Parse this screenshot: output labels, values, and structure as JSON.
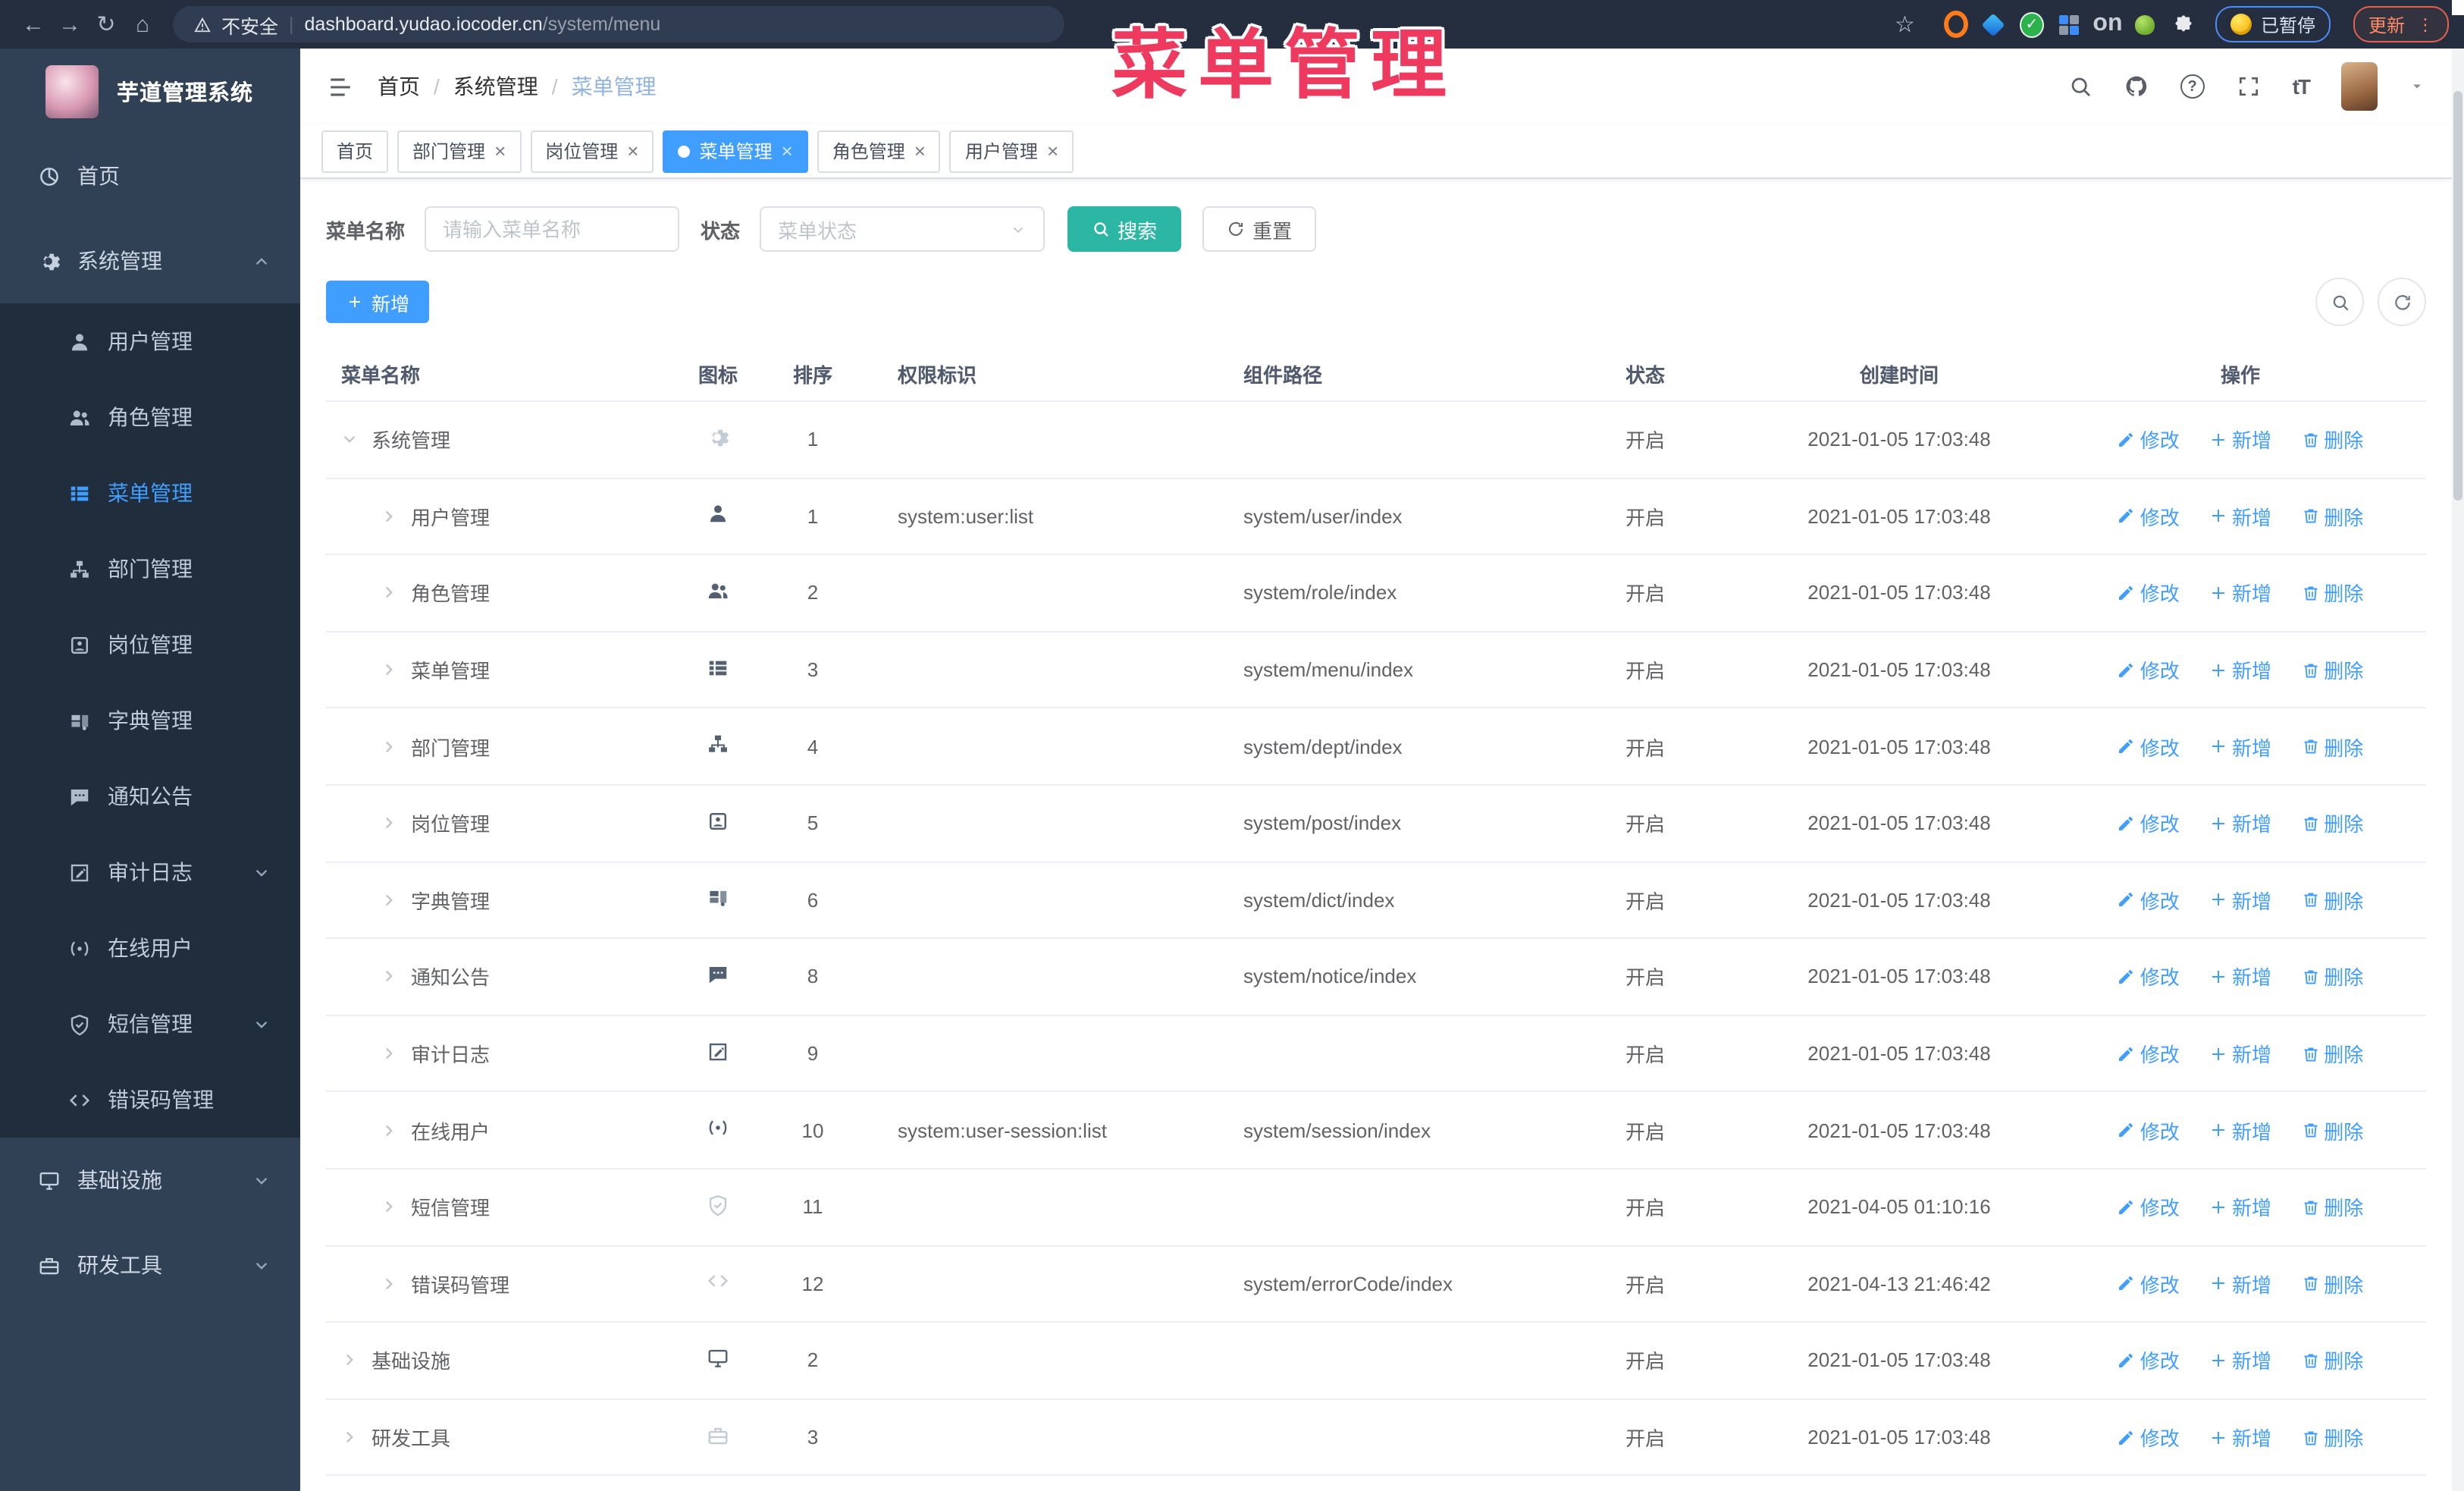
{
  "browser": {
    "security_label": "不安全",
    "url_host": "dashboard.yudao.iocoder.cn",
    "url_path": "/system/menu",
    "paused_label": "已暂停",
    "update_label": "更新"
  },
  "overlay_title": "菜单管理",
  "colors": {
    "accent": "#409eff",
    "search_button": "#2cb7a4",
    "overlay": "#ee3a5f",
    "sidebar": "#304156",
    "submenu": "#1f2d3d"
  },
  "sidebar": {
    "app_title": "芋道管理系统",
    "items": [
      {
        "label": "首页",
        "icon": "dashboard",
        "type": "top",
        "active": false,
        "arrow": ""
      },
      {
        "label": "系统管理",
        "icon": "gear",
        "type": "top",
        "active": false,
        "arrow": "up"
      },
      {
        "label": "用户管理",
        "icon": "user",
        "type": "sub",
        "active": false,
        "arrow": ""
      },
      {
        "label": "角色管理",
        "icon": "users",
        "type": "sub",
        "active": false,
        "arrow": ""
      },
      {
        "label": "菜单管理",
        "icon": "menu",
        "type": "sub",
        "active": true,
        "arrow": ""
      },
      {
        "label": "部门管理",
        "icon": "tree",
        "type": "sub",
        "active": false,
        "arrow": ""
      },
      {
        "label": "岗位管理",
        "icon": "post",
        "type": "sub",
        "active": false,
        "arrow": ""
      },
      {
        "label": "字典管理",
        "icon": "dict",
        "type": "sub",
        "active": false,
        "arrow": ""
      },
      {
        "label": "通知公告",
        "icon": "message",
        "type": "sub",
        "active": false,
        "arrow": ""
      },
      {
        "label": "审计日志",
        "icon": "log",
        "type": "sub",
        "active": false,
        "arrow": "down"
      },
      {
        "label": "在线用户",
        "icon": "online",
        "type": "sub",
        "active": false,
        "arrow": ""
      },
      {
        "label": "短信管理",
        "icon": "shield",
        "type": "sub",
        "active": false,
        "arrow": "down"
      },
      {
        "label": "错误码管理",
        "icon": "code",
        "type": "sub",
        "active": false,
        "arrow": ""
      },
      {
        "label": "基础设施",
        "icon": "monitor",
        "type": "top",
        "active": false,
        "arrow": "down"
      },
      {
        "label": "研发工具",
        "icon": "tool",
        "type": "top",
        "active": false,
        "arrow": "down"
      }
    ]
  },
  "breadcrumb": [
    "首页",
    "系统管理",
    "菜单管理"
  ],
  "tabs": [
    {
      "label": "首页",
      "active": false,
      "closable": false
    },
    {
      "label": "部门管理",
      "active": false,
      "closable": true
    },
    {
      "label": "岗位管理",
      "active": false,
      "closable": true
    },
    {
      "label": "菜单管理",
      "active": true,
      "closable": true
    },
    {
      "label": "角色管理",
      "active": false,
      "closable": true
    },
    {
      "label": "用户管理",
      "active": false,
      "closable": true
    }
  ],
  "filters": {
    "name_label": "菜单名称",
    "name_placeholder": "请输入菜单名称",
    "status_label": "状态",
    "status_placeholder": "菜单状态",
    "search_label": "搜索",
    "reset_label": "重置"
  },
  "toolbar": {
    "add_label": "新增"
  },
  "header_tools": {
    "font_tool": "tT",
    "help_glyph": "?"
  },
  "table": {
    "columns": [
      "菜单名称",
      "图标",
      "排序",
      "权限标识",
      "组件路径",
      "状态",
      "创建时间",
      "操作"
    ],
    "action_labels": [
      "修改",
      "新增",
      "删除"
    ],
    "rows": [
      {
        "name": "系统管理",
        "icon": "gear",
        "muted": true,
        "level": 0,
        "caret": "down",
        "order": "1",
        "perm": "",
        "path": "",
        "status": "开启",
        "time": "2021-01-05 17:03:48"
      },
      {
        "name": "用户管理",
        "icon": "user",
        "muted": false,
        "level": 1,
        "caret": "right",
        "order": "1",
        "perm": "system:user:list",
        "path": "system/user/index",
        "status": "开启",
        "time": "2021-01-05 17:03:48"
      },
      {
        "name": "角色管理",
        "icon": "users",
        "muted": false,
        "level": 1,
        "caret": "right",
        "order": "2",
        "perm": "",
        "path": "system/role/index",
        "status": "开启",
        "time": "2021-01-05 17:03:48"
      },
      {
        "name": "菜单管理",
        "icon": "menu",
        "muted": false,
        "level": 1,
        "caret": "right",
        "order": "3",
        "perm": "",
        "path": "system/menu/index",
        "status": "开启",
        "time": "2021-01-05 17:03:48"
      },
      {
        "name": "部门管理",
        "icon": "tree",
        "muted": false,
        "level": 1,
        "caret": "right",
        "order": "4",
        "perm": "",
        "path": "system/dept/index",
        "status": "开启",
        "time": "2021-01-05 17:03:48"
      },
      {
        "name": "岗位管理",
        "icon": "post",
        "muted": false,
        "level": 1,
        "caret": "right",
        "order": "5",
        "perm": "",
        "path": "system/post/index",
        "status": "开启",
        "time": "2021-01-05 17:03:48"
      },
      {
        "name": "字典管理",
        "icon": "dict",
        "muted": false,
        "level": 1,
        "caret": "right",
        "order": "6",
        "perm": "",
        "path": "system/dict/index",
        "status": "开启",
        "time": "2021-01-05 17:03:48"
      },
      {
        "name": "通知公告",
        "icon": "message",
        "muted": false,
        "level": 1,
        "caret": "right",
        "order": "8",
        "perm": "",
        "path": "system/notice/index",
        "status": "开启",
        "time": "2021-01-05 17:03:48"
      },
      {
        "name": "审计日志",
        "icon": "log",
        "muted": false,
        "level": 1,
        "caret": "right",
        "order": "9",
        "perm": "",
        "path": "",
        "status": "开启",
        "time": "2021-01-05 17:03:48"
      },
      {
        "name": "在线用户",
        "icon": "online",
        "muted": false,
        "level": 1,
        "caret": "right",
        "order": "10",
        "perm": "system:user-session:list",
        "path": "system/session/index",
        "status": "开启",
        "time": "2021-01-05 17:03:48"
      },
      {
        "name": "短信管理",
        "icon": "shield",
        "muted": true,
        "level": 1,
        "caret": "right",
        "order": "11",
        "perm": "",
        "path": "",
        "status": "开启",
        "time": "2021-04-05 01:10:16"
      },
      {
        "name": "错误码管理",
        "icon": "code",
        "muted": true,
        "level": 1,
        "caret": "right",
        "order": "12",
        "perm": "",
        "path": "system/errorCode/index",
        "status": "开启",
        "time": "2021-04-13 21:46:42"
      },
      {
        "name": "基础设施",
        "icon": "monitor",
        "muted": false,
        "level": 0,
        "caret": "right",
        "order": "2",
        "perm": "",
        "path": "",
        "status": "开启",
        "time": "2021-01-05 17:03:48"
      },
      {
        "name": "研发工具",
        "icon": "tool",
        "muted": true,
        "level": 0,
        "caret": "right",
        "order": "3",
        "perm": "",
        "path": "",
        "status": "开启",
        "time": "2021-01-05 17:03:48"
      }
    ]
  }
}
